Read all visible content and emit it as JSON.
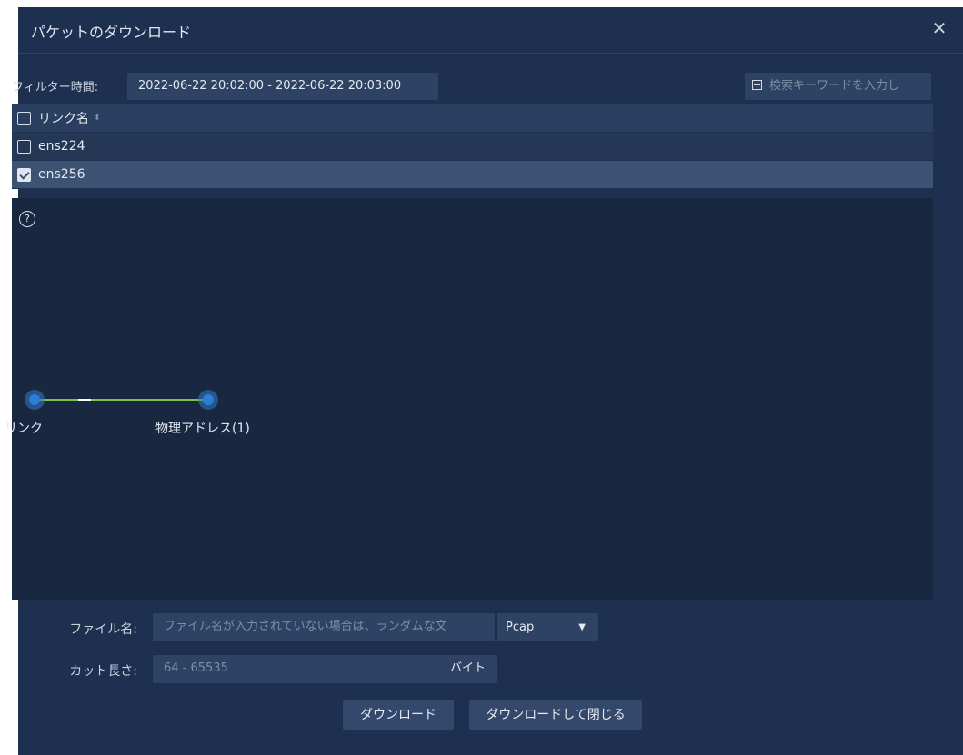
{
  "dialog": {
    "title": "パケットのダウンロード",
    "close_icon": "close-icon"
  },
  "filter": {
    "label": "フィルター時間:",
    "time_range": "2022-06-22 20:02:00 - 2022-06-22 20:03:00",
    "search_placeholder": "検索キーワードを入力し"
  },
  "table": {
    "header": "リンク名",
    "rows": [
      {
        "name": "ens224",
        "checked": false
      },
      {
        "name": "ens256",
        "checked": true
      }
    ]
  },
  "graph": {
    "help_icon": "help-icon",
    "nodes": [
      {
        "label": "リンク"
      },
      {
        "label": "物理アドレス(1)"
      }
    ],
    "colors": {
      "edge": "#7dc242",
      "node": "#2f7dd6"
    }
  },
  "form": {
    "filename_label": "ファイル名:",
    "filename_placeholder": "ファイル名が入力されていない場合は、ランダムな文",
    "format_value": "Pcap",
    "cut_length_label": "カット長さ:",
    "cut_length_placeholder": "64 - 65535",
    "cut_length_unit": "バイト"
  },
  "buttons": {
    "download": "ダウンロード",
    "download_close": "ダウンロードして閉じる"
  }
}
